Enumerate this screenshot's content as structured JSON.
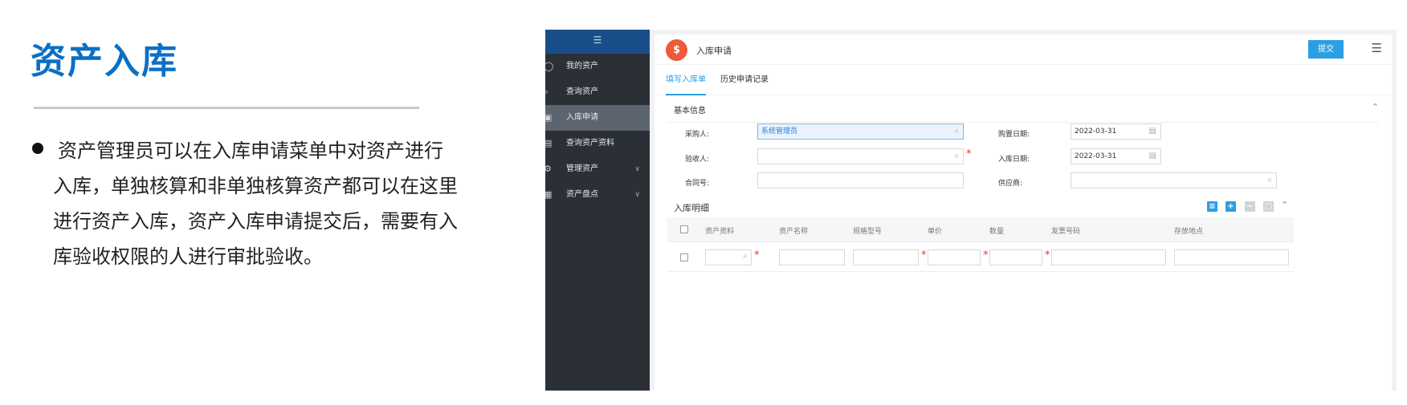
{
  "slide": {
    "title": "资产入库",
    "desc_lines": [
      "资产管理员可以在入库申请菜单中对资产进行",
      "入库，单独核算和非单独核算资产都可以在这里",
      "进行资产入库，资产入库申请提交后，需要有入",
      "库验收权限的人进行审批验收。"
    ]
  },
  "sidebar": {
    "collapse_glyph": "☰",
    "items": [
      {
        "label": "我的资产",
        "icon": "money-bag-icon",
        "active": false
      },
      {
        "label": "查询资产",
        "icon": "search-icon",
        "active": false
      },
      {
        "label": "入库申请",
        "icon": "inbox-icon",
        "active": true
      },
      {
        "label": "查询资产资料",
        "icon": "document-icon",
        "active": false
      },
      {
        "label": "管理资产",
        "icon": "gear-icon",
        "active": false,
        "expandable": true
      },
      {
        "label": "资产盘点",
        "icon": "clipboard-icon",
        "active": false,
        "expandable": true
      }
    ]
  },
  "header": {
    "page_title": "入库申请",
    "submit_label": "提交",
    "brand_color": "#ee5a3a",
    "accent_color": "#2b9fe3"
  },
  "tabs": [
    {
      "label": "填写入库单",
      "active": true
    },
    {
      "label": "历史申请记录",
      "active": false
    }
  ],
  "basic_info": {
    "section_title": "基本信息",
    "buyer_label": "采购人:",
    "buyer_value": "系统管理员",
    "purchase_date_label": "购置日期:",
    "purchase_date_value": "2022-03-31",
    "inspector_label": "验收人:",
    "inspector_value": "",
    "inbound_date_label": "入库日期:",
    "inbound_date_value": "2022-03-31",
    "contract_label": "合同号:",
    "contract_value": "",
    "supplier_label": "供应商:",
    "supplier_value": ""
  },
  "detail": {
    "section_title": "入库明细",
    "columns": [
      "资产资料",
      "资产名称",
      "规格型号",
      "单价",
      "数量",
      "发票号码",
      "存放地点"
    ],
    "required_mark": "*"
  }
}
